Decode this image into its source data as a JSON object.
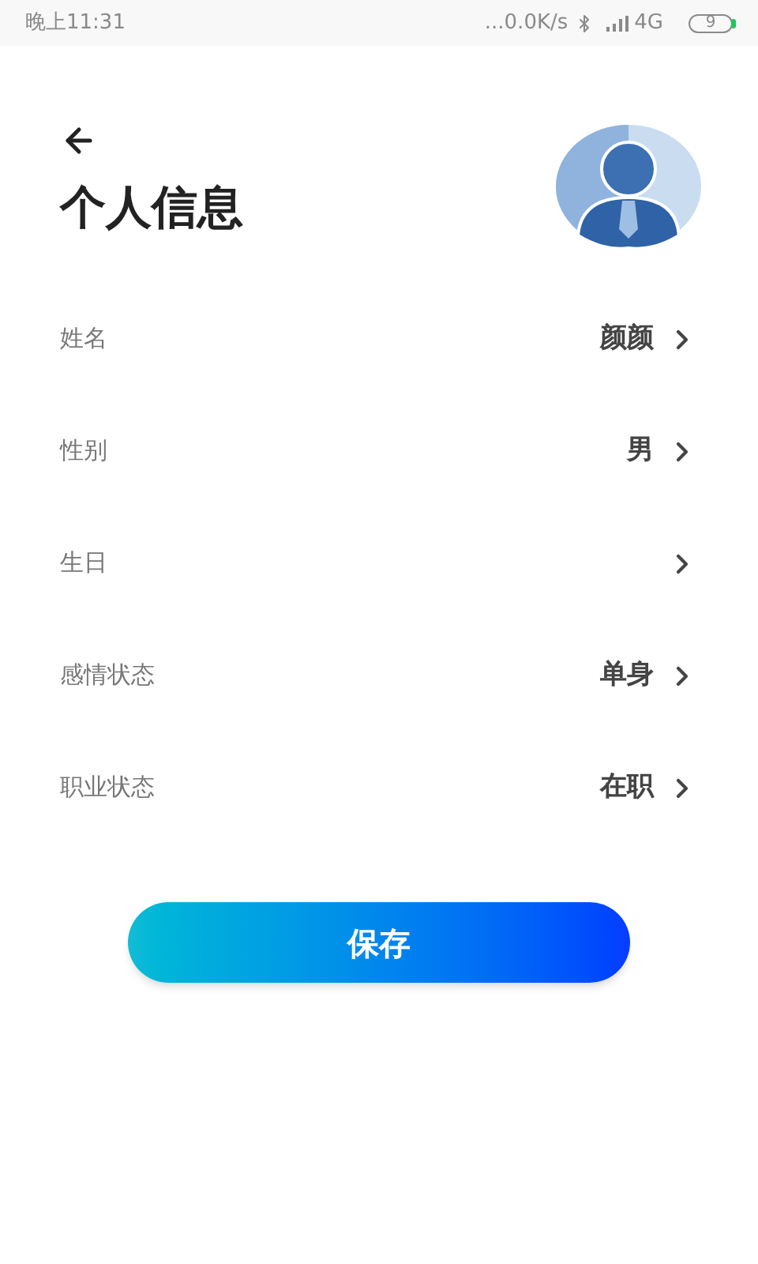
{
  "status_bar": {
    "time": "晚上11:31",
    "speed": "...0.0K/s",
    "network": "4G",
    "battery": "9"
  },
  "header": {
    "title": "个人信息"
  },
  "rows": [
    {
      "label": "姓名",
      "value": "颜颜"
    },
    {
      "label": "性别",
      "value": "男"
    },
    {
      "label": "生日"
    },
    {
      "label": "感情状态",
      "value": "单身"
    },
    {
      "label": "职业状态",
      "value": "在职"
    }
  ],
  "save_button": "保存"
}
